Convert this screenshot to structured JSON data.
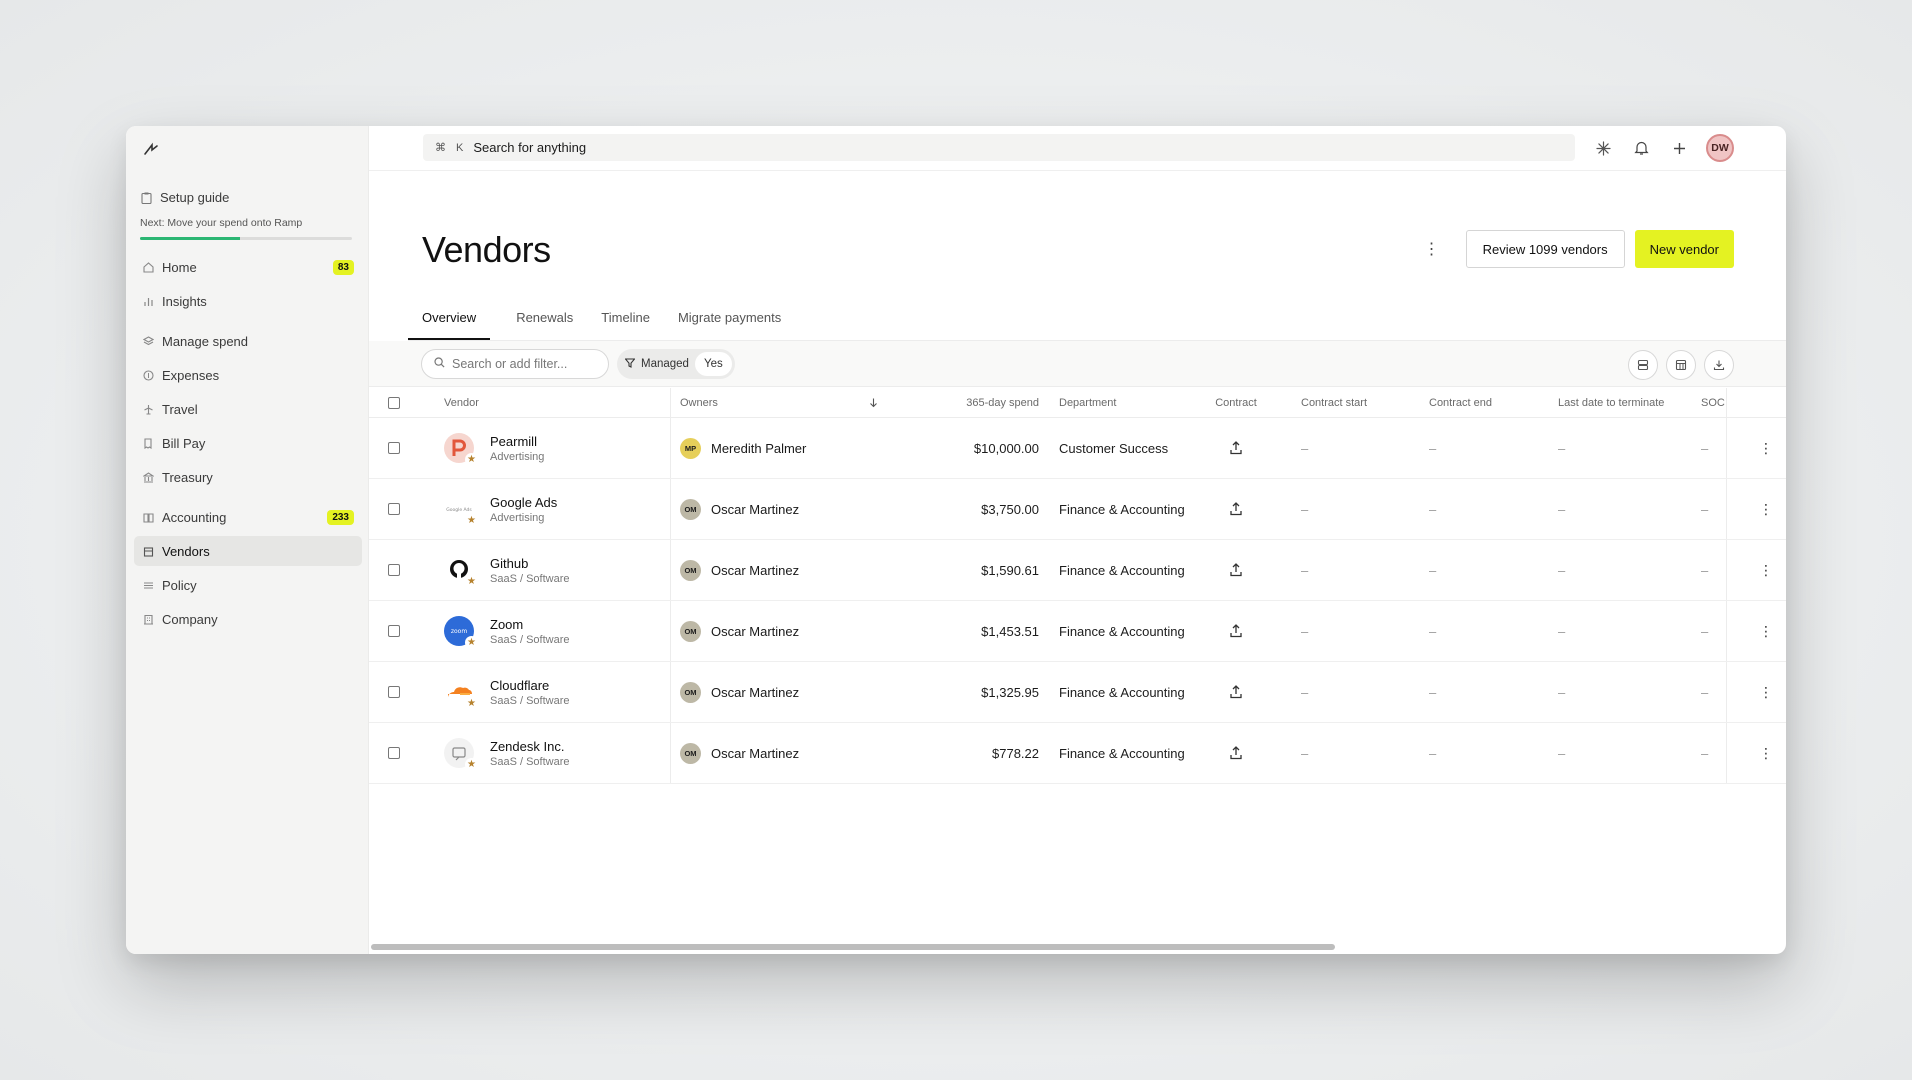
{
  "sidebar": {
    "setup": {
      "title": "Setup guide",
      "next": "Next: Move your spend onto Ramp",
      "progress": 0.47
    },
    "groups": [
      [
        {
          "label": "Home",
          "icon": "home-icon",
          "badge": "83"
        },
        {
          "label": "Insights",
          "icon": "bar-chart-icon"
        }
      ],
      [
        {
          "label": "Manage spend",
          "icon": "layers-icon"
        },
        {
          "label": "Expenses",
          "icon": "dollar-icon"
        },
        {
          "label": "Travel",
          "icon": "plane-icon"
        },
        {
          "label": "Bill Pay",
          "icon": "bill-icon"
        },
        {
          "label": "Treasury",
          "icon": "bank-icon"
        }
      ],
      [
        {
          "label": "Accounting",
          "icon": "book-icon",
          "badge": "233"
        },
        {
          "label": "Vendors",
          "icon": "store-icon",
          "active": true
        },
        {
          "label": "Policy",
          "icon": "sliders-icon"
        },
        {
          "label": "Company",
          "icon": "building-icon"
        }
      ]
    ]
  },
  "topbar": {
    "shortcut_cmd": "⌘",
    "shortcut_key": "K",
    "search_placeholder": "Search for anything",
    "avatar_initials": "DW"
  },
  "page": {
    "title": "Vendors",
    "review_button": "Review 1099 vendors",
    "new_button": "New vendor"
  },
  "tabs": [
    "Overview",
    "Renewals",
    "Timeline",
    "Migrate payments"
  ],
  "active_tab": 0,
  "filters": {
    "search_placeholder": "Search or add filter...",
    "chip_label": "Managed",
    "chip_value": "Yes"
  },
  "table": {
    "columns": {
      "vendor": "Vendor",
      "owners": "Owners",
      "spend": "365-day spend",
      "department": "Department",
      "contract": "Contract",
      "contract_start": "Contract start",
      "contract_end": "Contract end",
      "last_date": "Last date to terminate",
      "soc": "SOC I"
    },
    "dash": "–",
    "rows": [
      {
        "name": "Pearmill",
        "category": "Advertising",
        "logo": "pearmill",
        "owner_initials": "MP",
        "owner": "Meredith Palmer",
        "owner_color": "#e6cf5a",
        "spend": "$10,000.00",
        "department": "Customer Success"
      },
      {
        "name": "Google Ads",
        "category": "Advertising",
        "logo": "google",
        "owner_initials": "OM",
        "owner": "Oscar Martinez",
        "owner_color": "#bdb8a6",
        "spend": "$3,750.00",
        "department": "Finance & Accounting"
      },
      {
        "name": "Github",
        "category": "SaaS / Software",
        "logo": "github",
        "owner_initials": "OM",
        "owner": "Oscar Martinez",
        "owner_color": "#bdb8a6",
        "spend": "$1,590.61",
        "department": "Finance & Accounting"
      },
      {
        "name": "Zoom",
        "category": "SaaS / Software",
        "logo": "zoom",
        "owner_initials": "OM",
        "owner": "Oscar Martinez",
        "owner_color": "#bdb8a6",
        "spend": "$1,453.51",
        "department": "Finance & Accounting"
      },
      {
        "name": "Cloudflare",
        "category": "SaaS / Software",
        "logo": "cloudflare",
        "owner_initials": "OM",
        "owner": "Oscar Martinez",
        "owner_color": "#bdb8a6",
        "spend": "$1,325.95",
        "department": "Finance & Accounting"
      },
      {
        "name": "Zendesk Inc.",
        "category": "SaaS / Software",
        "logo": "zendesk",
        "owner_initials": "OM",
        "owner": "Oscar Martinez",
        "owner_color": "#bdb8a6",
        "spend": "$778.22",
        "department": "Finance & Accounting"
      }
    ]
  },
  "colors": {
    "accent": "#e4f222",
    "progress": "#2bb673"
  }
}
